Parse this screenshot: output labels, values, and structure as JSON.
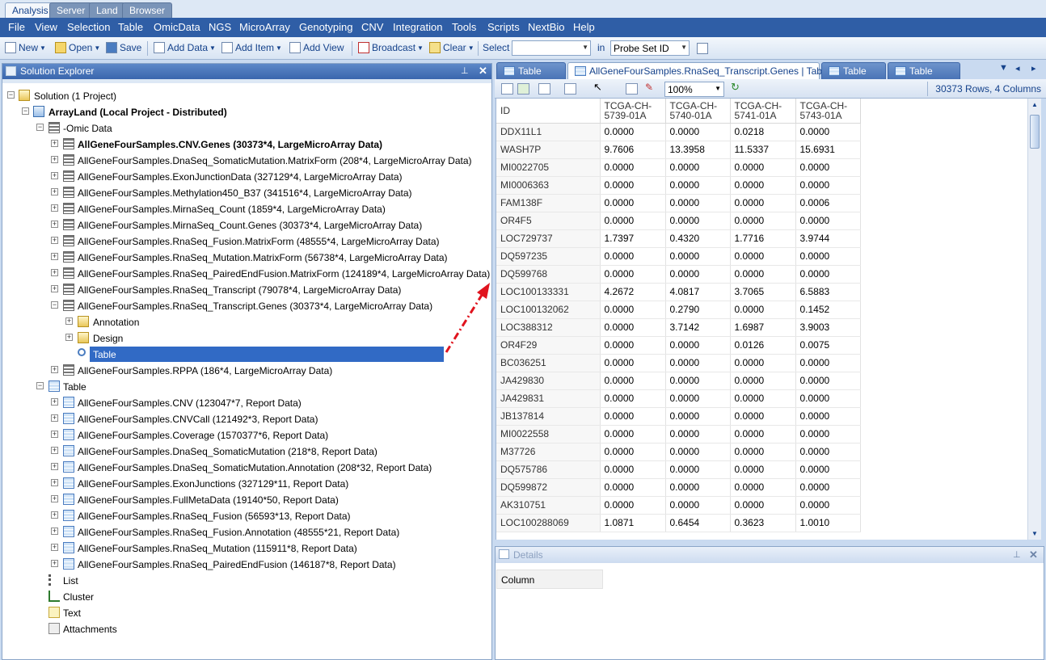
{
  "app_tabs": [
    "Analysis",
    "Server",
    "Land",
    "Browser"
  ],
  "menu": [
    "File",
    "View",
    "Selection",
    "Table",
    "OmicData",
    "NGS",
    "MicroArray",
    "Genotyping",
    "CNV",
    "Integration",
    "Tools",
    "Scripts",
    "NextBio",
    "Help"
  ],
  "toolbar": {
    "new_label": "New",
    "open_label": "Open",
    "save_label": "Save",
    "add_data_label": "Add Data",
    "add_item_label": "Add Item",
    "add_view_label": "Add View",
    "broadcast_label": "Broadcast",
    "clear_label": "Clear",
    "select_label": "Select",
    "select_value": "",
    "in_label": "in",
    "in_value": "Probe Set ID"
  },
  "solution_explorer": {
    "title": "Solution Explorer",
    "solution_label": "Solution (1 Project)",
    "project_label": "ArrayLand (Local Project - Distributed)",
    "omic_folder": "-Omic Data",
    "omic_items": [
      "AllGeneFourSamples.CNV.Genes (30373*4, LargeMicroArray Data)",
      "AllGeneFourSamples.DnaSeq_SomaticMutation.MatrixForm (208*4, LargeMicroArray Data)",
      "AllGeneFourSamples.ExonJunctionData (327129*4, LargeMicroArray Data)",
      "AllGeneFourSamples.Methylation450_B37 (341516*4, LargeMicroArray Data)",
      "AllGeneFourSamples.MirnaSeq_Count (1859*4, LargeMicroArray Data)",
      "AllGeneFourSamples.MirnaSeq_Count.Genes (30373*4, LargeMicroArray Data)",
      "AllGeneFourSamples.RnaSeq_Fusion.MatrixForm (48555*4, LargeMicroArray Data)",
      "AllGeneFourSamples.RnaSeq_Mutation.MatrixForm (56738*4, LargeMicroArray Data)",
      "AllGeneFourSamples.RnaSeq_PairedEndFusion.MatrixForm (124189*4, LargeMicroArray Data)",
      "AllGeneFourSamples.RnaSeq_Transcript (79078*4, LargeMicroArray Data)",
      "AllGeneFourSamples.RnaSeq_Transcript.Genes (30373*4, LargeMicroArray Data)"
    ],
    "sub_items": [
      "Annotation",
      "Design",
      "Table"
    ],
    "rppa_item": "AllGeneFourSamples.RPPA (186*4, LargeMicroArray Data)",
    "table_folder": "Table",
    "table_items": [
      "AllGeneFourSamples.CNV (123047*7, Report Data)",
      "AllGeneFourSamples.CNVCall (121492*3, Report Data)",
      "AllGeneFourSamples.Coverage (1570377*6, Report Data)",
      "AllGeneFourSamples.DnaSeq_SomaticMutation (218*8, Report Data)",
      "AllGeneFourSamples.DnaSeq_SomaticMutation.Annotation (208*32, Report Data)",
      "AllGeneFourSamples.ExonJunctions (327129*11, Report Data)",
      "AllGeneFourSamples.FullMetaData (19140*50, Report Data)",
      "AllGeneFourSamples.RnaSeq_Fusion (56593*13, Report Data)",
      "AllGeneFourSamples.RnaSeq_Fusion.Annotation (48555*21, Report Data)",
      "AllGeneFourSamples.RnaSeq_Mutation (115911*8, Report Data)",
      "AllGeneFourSamples.RnaSeq_PairedEndFusion (146187*8, Report Data)"
    ],
    "other_items": [
      "List",
      "Cluster",
      "Text",
      "Attachments"
    ]
  },
  "doc_tabs": [
    "Table",
    "AllGeneFourSamples.RnaSeq_Transcript.Genes | Table",
    "Table",
    "Table"
  ],
  "grid_toolbar": {
    "zoom": "100%",
    "row_count": "30373 Rows, 4 Columns"
  },
  "grid": {
    "columns": [
      "ID",
      "TCGA-CH-5739-01A",
      "TCGA-CH-5740-01A",
      "TCGA-CH-5741-01A",
      "TCGA-CH-5743-01A"
    ],
    "rows": [
      [
        "DDX11L1",
        "0.0000",
        "0.0000",
        "0.0218",
        "0.0000"
      ],
      [
        "WASH7P",
        "9.7606",
        "13.3958",
        "11.5337",
        "15.6931"
      ],
      [
        "MI0022705",
        "0.0000",
        "0.0000",
        "0.0000",
        "0.0000"
      ],
      [
        "MI0006363",
        "0.0000",
        "0.0000",
        "0.0000",
        "0.0000"
      ],
      [
        "FAM138F",
        "0.0000",
        "0.0000",
        "0.0000",
        "0.0006"
      ],
      [
        "OR4F5",
        "0.0000",
        "0.0000",
        "0.0000",
        "0.0000"
      ],
      [
        "LOC729737",
        "1.7397",
        "0.4320",
        "1.7716",
        "3.9744"
      ],
      [
        "DQ597235",
        "0.0000",
        "0.0000",
        "0.0000",
        "0.0000"
      ],
      [
        "DQ599768",
        "0.0000",
        "0.0000",
        "0.0000",
        "0.0000"
      ],
      [
        "LOC100133331",
        "4.2672",
        "4.0817",
        "3.7065",
        "6.5883"
      ],
      [
        "LOC100132062",
        "0.0000",
        "0.2790",
        "0.0000",
        "0.1452"
      ],
      [
        "LOC388312",
        "0.0000",
        "3.7142",
        "1.6987",
        "3.9003"
      ],
      [
        "OR4F29",
        "0.0000",
        "0.0000",
        "0.0126",
        "0.0075"
      ],
      [
        "BC036251",
        "0.0000",
        "0.0000",
        "0.0000",
        "0.0000"
      ],
      [
        "JA429830",
        "0.0000",
        "0.0000",
        "0.0000",
        "0.0000"
      ],
      [
        "JA429831",
        "0.0000",
        "0.0000",
        "0.0000",
        "0.0000"
      ],
      [
        "JB137814",
        "0.0000",
        "0.0000",
        "0.0000",
        "0.0000"
      ],
      [
        "MI0022558",
        "0.0000",
        "0.0000",
        "0.0000",
        "0.0000"
      ],
      [
        "M37726",
        "0.0000",
        "0.0000",
        "0.0000",
        "0.0000"
      ],
      [
        "DQ575786",
        "0.0000",
        "0.0000",
        "0.0000",
        "0.0000"
      ],
      [
        "DQ599872",
        "0.0000",
        "0.0000",
        "0.0000",
        "0.0000"
      ],
      [
        "AK310751",
        "0.0000",
        "0.0000",
        "0.0000",
        "0.0000"
      ],
      [
        "LOC100288069",
        "1.0871",
        "0.6454",
        "0.3623",
        "1.0010"
      ]
    ]
  },
  "details": {
    "title": "Details",
    "column_header": "Column"
  },
  "colors": {
    "menubar": "#2f5ea6",
    "selection": "#316ac5",
    "arrow": "#e0141e"
  }
}
